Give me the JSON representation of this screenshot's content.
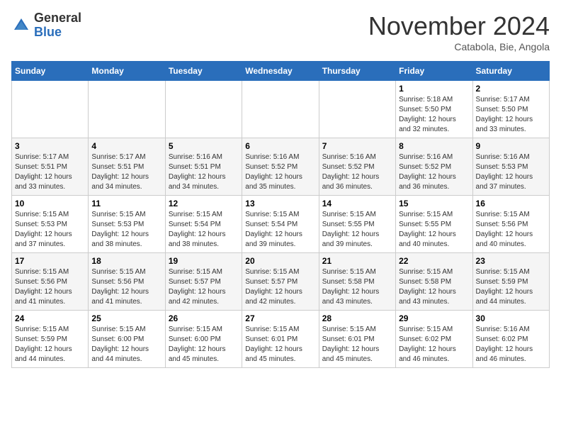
{
  "header": {
    "logo_line1": "General",
    "logo_line2": "Blue",
    "month": "November 2024",
    "location": "Catabola, Bie, Angola"
  },
  "days_of_week": [
    "Sunday",
    "Monday",
    "Tuesday",
    "Wednesday",
    "Thursday",
    "Friday",
    "Saturday"
  ],
  "weeks": [
    [
      {
        "day": "",
        "info": ""
      },
      {
        "day": "",
        "info": ""
      },
      {
        "day": "",
        "info": ""
      },
      {
        "day": "",
        "info": ""
      },
      {
        "day": "",
        "info": ""
      },
      {
        "day": "1",
        "info": "Sunrise: 5:18 AM\nSunset: 5:50 PM\nDaylight: 12 hours\nand 32 minutes."
      },
      {
        "day": "2",
        "info": "Sunrise: 5:17 AM\nSunset: 5:50 PM\nDaylight: 12 hours\nand 33 minutes."
      }
    ],
    [
      {
        "day": "3",
        "info": "Sunrise: 5:17 AM\nSunset: 5:51 PM\nDaylight: 12 hours\nand 33 minutes."
      },
      {
        "day": "4",
        "info": "Sunrise: 5:17 AM\nSunset: 5:51 PM\nDaylight: 12 hours\nand 34 minutes."
      },
      {
        "day": "5",
        "info": "Sunrise: 5:16 AM\nSunset: 5:51 PM\nDaylight: 12 hours\nand 34 minutes."
      },
      {
        "day": "6",
        "info": "Sunrise: 5:16 AM\nSunset: 5:52 PM\nDaylight: 12 hours\nand 35 minutes."
      },
      {
        "day": "7",
        "info": "Sunrise: 5:16 AM\nSunset: 5:52 PM\nDaylight: 12 hours\nand 36 minutes."
      },
      {
        "day": "8",
        "info": "Sunrise: 5:16 AM\nSunset: 5:52 PM\nDaylight: 12 hours\nand 36 minutes."
      },
      {
        "day": "9",
        "info": "Sunrise: 5:16 AM\nSunset: 5:53 PM\nDaylight: 12 hours\nand 37 minutes."
      }
    ],
    [
      {
        "day": "10",
        "info": "Sunrise: 5:15 AM\nSunset: 5:53 PM\nDaylight: 12 hours\nand 37 minutes."
      },
      {
        "day": "11",
        "info": "Sunrise: 5:15 AM\nSunset: 5:53 PM\nDaylight: 12 hours\nand 38 minutes."
      },
      {
        "day": "12",
        "info": "Sunrise: 5:15 AM\nSunset: 5:54 PM\nDaylight: 12 hours\nand 38 minutes."
      },
      {
        "day": "13",
        "info": "Sunrise: 5:15 AM\nSunset: 5:54 PM\nDaylight: 12 hours\nand 39 minutes."
      },
      {
        "day": "14",
        "info": "Sunrise: 5:15 AM\nSunset: 5:55 PM\nDaylight: 12 hours\nand 39 minutes."
      },
      {
        "day": "15",
        "info": "Sunrise: 5:15 AM\nSunset: 5:55 PM\nDaylight: 12 hours\nand 40 minutes."
      },
      {
        "day": "16",
        "info": "Sunrise: 5:15 AM\nSunset: 5:56 PM\nDaylight: 12 hours\nand 40 minutes."
      }
    ],
    [
      {
        "day": "17",
        "info": "Sunrise: 5:15 AM\nSunset: 5:56 PM\nDaylight: 12 hours\nand 41 minutes."
      },
      {
        "day": "18",
        "info": "Sunrise: 5:15 AM\nSunset: 5:56 PM\nDaylight: 12 hours\nand 41 minutes."
      },
      {
        "day": "19",
        "info": "Sunrise: 5:15 AM\nSunset: 5:57 PM\nDaylight: 12 hours\nand 42 minutes."
      },
      {
        "day": "20",
        "info": "Sunrise: 5:15 AM\nSunset: 5:57 PM\nDaylight: 12 hours\nand 42 minutes."
      },
      {
        "day": "21",
        "info": "Sunrise: 5:15 AM\nSunset: 5:58 PM\nDaylight: 12 hours\nand 43 minutes."
      },
      {
        "day": "22",
        "info": "Sunrise: 5:15 AM\nSunset: 5:58 PM\nDaylight: 12 hours\nand 43 minutes."
      },
      {
        "day": "23",
        "info": "Sunrise: 5:15 AM\nSunset: 5:59 PM\nDaylight: 12 hours\nand 44 minutes."
      }
    ],
    [
      {
        "day": "24",
        "info": "Sunrise: 5:15 AM\nSunset: 5:59 PM\nDaylight: 12 hours\nand 44 minutes."
      },
      {
        "day": "25",
        "info": "Sunrise: 5:15 AM\nSunset: 6:00 PM\nDaylight: 12 hours\nand 44 minutes."
      },
      {
        "day": "26",
        "info": "Sunrise: 5:15 AM\nSunset: 6:00 PM\nDaylight: 12 hours\nand 45 minutes."
      },
      {
        "day": "27",
        "info": "Sunrise: 5:15 AM\nSunset: 6:01 PM\nDaylight: 12 hours\nand 45 minutes."
      },
      {
        "day": "28",
        "info": "Sunrise: 5:15 AM\nSunset: 6:01 PM\nDaylight: 12 hours\nand 45 minutes."
      },
      {
        "day": "29",
        "info": "Sunrise: 5:15 AM\nSunset: 6:02 PM\nDaylight: 12 hours\nand 46 minutes."
      },
      {
        "day": "30",
        "info": "Sunrise: 5:16 AM\nSunset: 6:02 PM\nDaylight: 12 hours\nand 46 minutes."
      }
    ]
  ]
}
